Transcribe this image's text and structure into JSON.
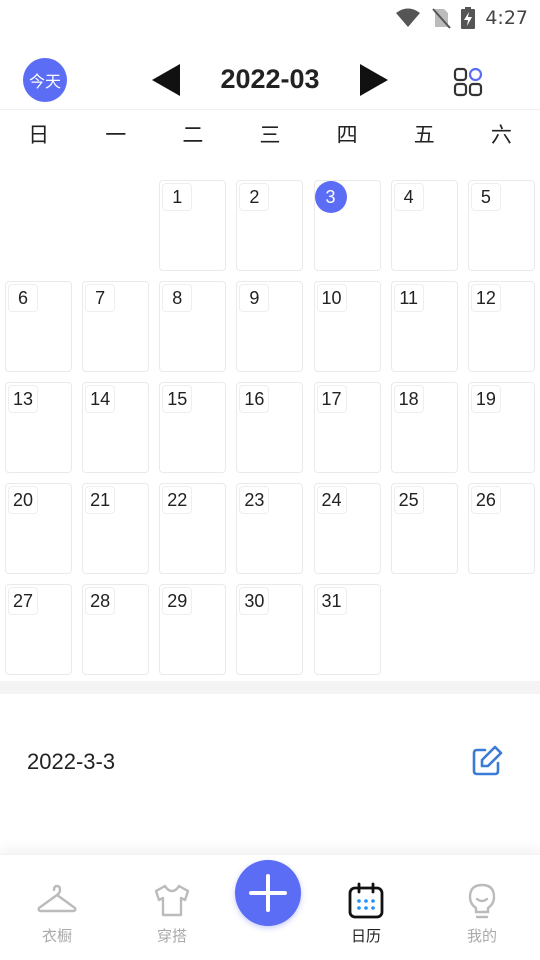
{
  "status_bar": {
    "time": "4:27",
    "icons": [
      "wifi-icon",
      "no-sim-icon",
      "battery-charging-icon"
    ]
  },
  "header": {
    "today_label": "今天",
    "month_title": "2022-03",
    "icons": {
      "prev": "triangle-left-icon",
      "next": "triangle-right-icon",
      "grid": "grid-view-icon"
    }
  },
  "weekdays": [
    "日",
    "一",
    "二",
    "三",
    "四",
    "五",
    "六"
  ],
  "calendar": {
    "first_weekday": 2,
    "days": [
      "1",
      "2",
      "3",
      "4",
      "5",
      "6",
      "7",
      "8",
      "9",
      "10",
      "11",
      "12",
      "13",
      "14",
      "15",
      "16",
      "17",
      "18",
      "19",
      "20",
      "21",
      "22",
      "23",
      "24",
      "25",
      "26",
      "27",
      "28",
      "29",
      "30",
      "31"
    ],
    "selected_day": "3"
  },
  "selected_date": {
    "label": "2022-3-3",
    "edit_icon": "edit-icon"
  },
  "bottom_nav": {
    "items": [
      {
        "label": "衣橱",
        "icon": "hanger-icon",
        "active": false
      },
      {
        "label": "穿搭",
        "icon": "tshirt-icon",
        "active": false
      },
      {
        "label": "日历",
        "icon": "calendar-icon",
        "active": true
      },
      {
        "label": "我的",
        "icon": "bulb-icon",
        "active": false
      }
    ],
    "add_icon": "plus-icon"
  },
  "colors": {
    "accent": "#5b6cf5",
    "edit": "#3a7bd5",
    "calendar_dots": "#1e90ff"
  }
}
